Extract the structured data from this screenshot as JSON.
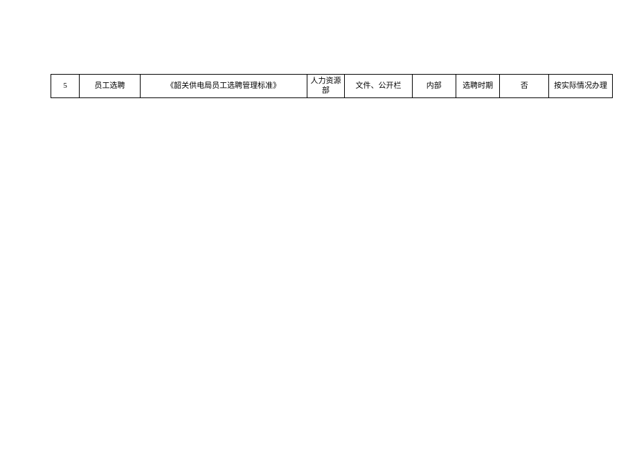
{
  "table": {
    "rows": [
      {
        "index": "5",
        "name": "员工选聘",
        "document": "《韶关供电局员工选聘管理标准》",
        "department": "人力资源部",
        "form": "文件、公开栏",
        "scope": "内部",
        "timing": "选聘时期",
        "fee": "否",
        "remark": "按实际情况办理"
      }
    ]
  }
}
